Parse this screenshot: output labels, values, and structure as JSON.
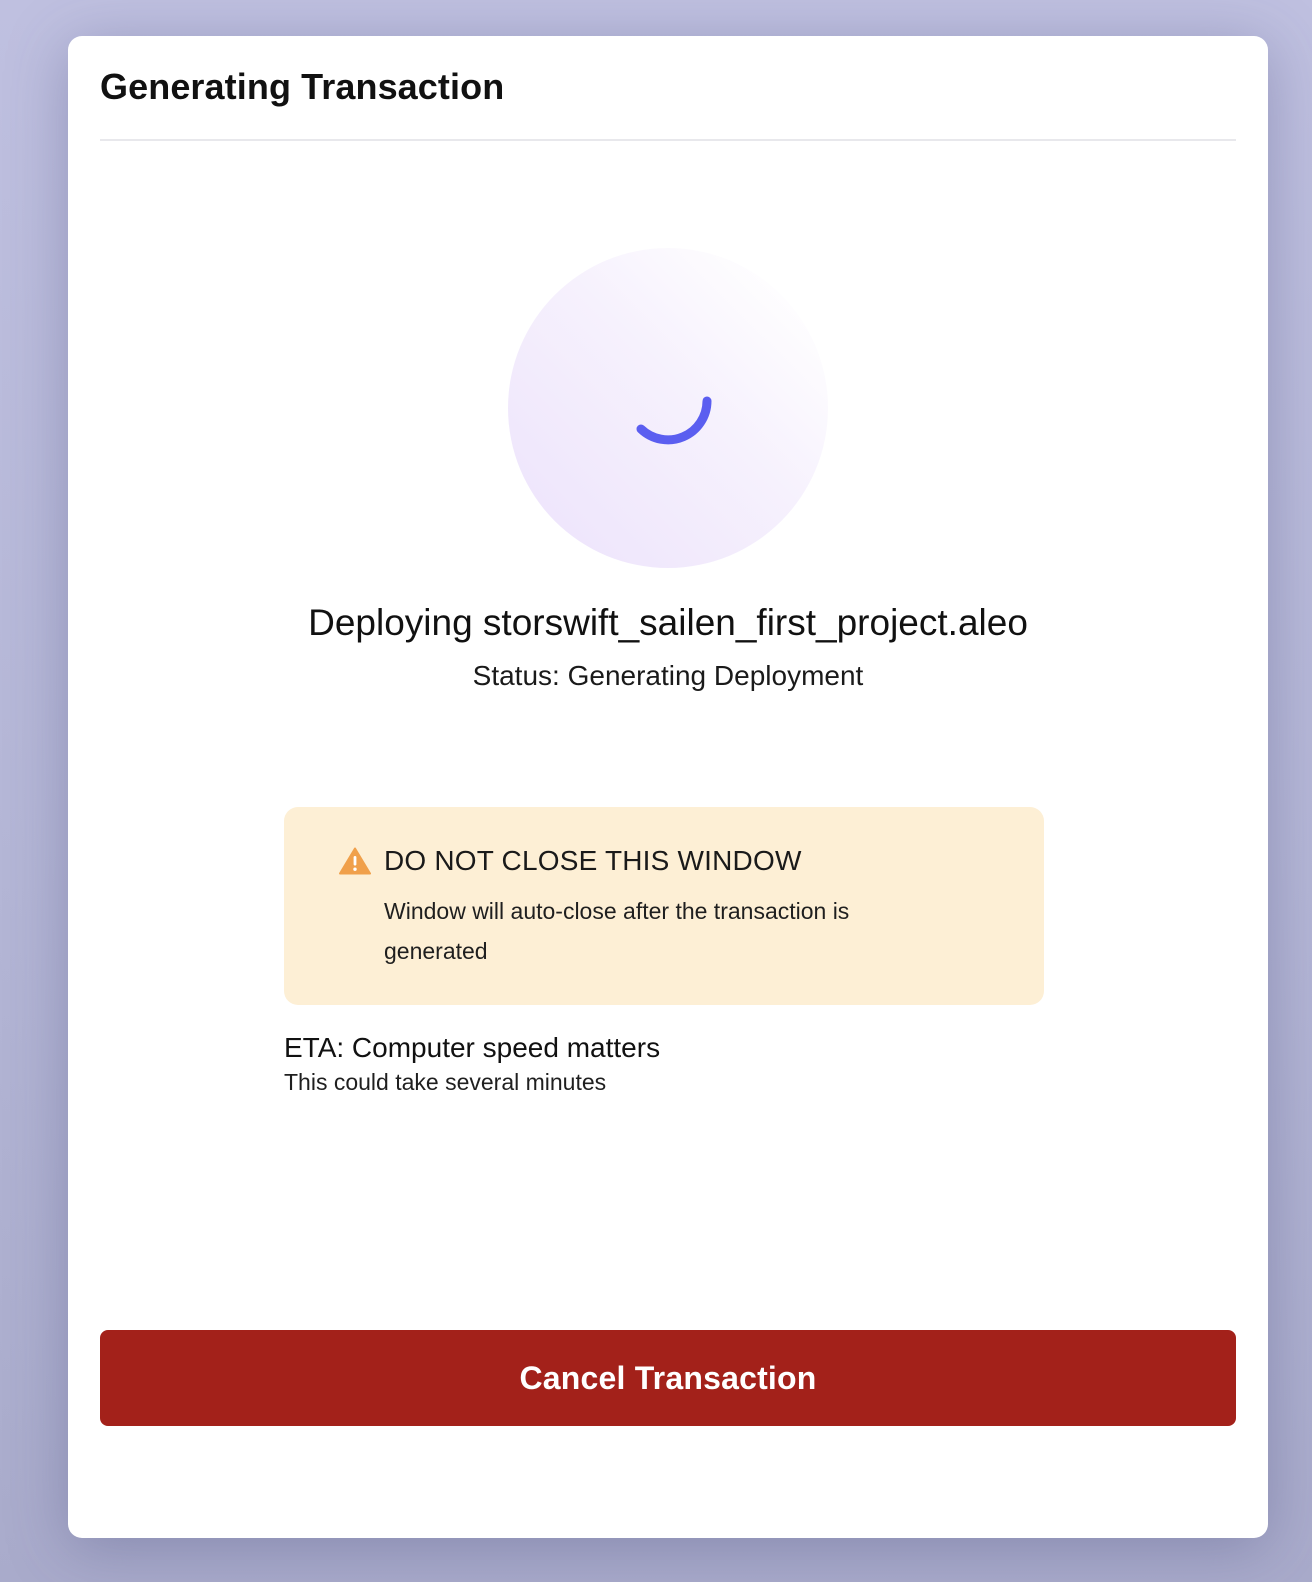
{
  "modal": {
    "title": "Generating Transaction"
  },
  "spinner": {
    "icon": "loading-spinner-icon",
    "color": "#5b5ef0"
  },
  "deployment": {
    "title": "Deploying storswift_sailen_first_project.aleo",
    "status": "Status: Generating Deployment"
  },
  "warning": {
    "icon": "warning-triangle-icon",
    "icon_color": "#f0a04b",
    "title": "DO NOT CLOSE THIS WINDOW",
    "text": "Window will auto-close after the transaction is generated"
  },
  "eta": {
    "title": "ETA: Computer speed matters",
    "text": "This could take several minutes"
  },
  "actions": {
    "cancel_label": "Cancel Transaction",
    "cancel_color": "#a3211a"
  }
}
